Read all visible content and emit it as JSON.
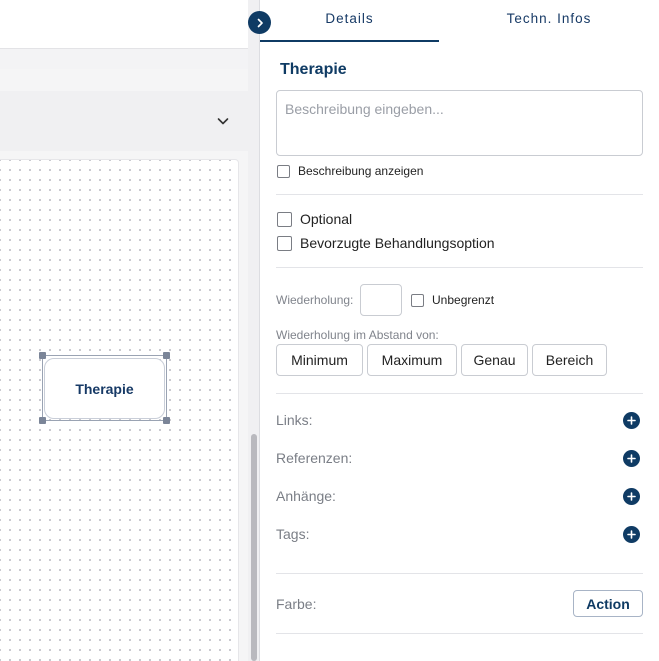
{
  "canvas": {
    "node_label": "Therapie"
  },
  "panel": {
    "tabs": [
      {
        "label": "Details"
      },
      {
        "label": "Techn. Infos"
      }
    ],
    "section_title": "Therapie",
    "description": {
      "value": "",
      "placeholder": "Beschreibung eingeben..."
    },
    "show_description_label": "Beschreibung anzeigen",
    "optional_label": "Optional",
    "preferred_label": "Bevorzugte Behandlungsoption",
    "repetition": {
      "label": "Wiederholung:",
      "value": "",
      "unlimited_label": "Unbegrenzt"
    },
    "interval": {
      "label": "Wiederholung im Abstand von:",
      "options": [
        "Minimum",
        "Maximum",
        "Genau",
        "Bereich"
      ]
    },
    "links_label": "Links:",
    "references_label": "Referenzen:",
    "attachments_label": "Anhänge:",
    "tags_label": "Tags:",
    "color": {
      "label": "Farbe:",
      "button_label": "Action"
    }
  },
  "colors": {
    "accent": "#0f3b64",
    "node_text": "#173a66",
    "border": "#c9ccd2"
  },
  "icons": [
    "chevron-down-icon",
    "chevron-right-icon",
    "plus-circle-icon"
  ]
}
